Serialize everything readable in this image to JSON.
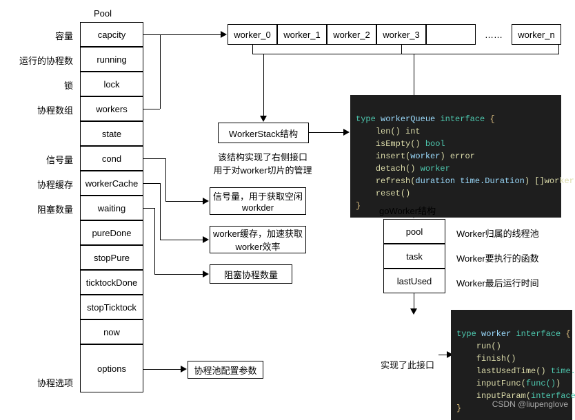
{
  "pool_title": "Pool",
  "pool_labels": {
    "capacity": "容量",
    "running": "运行的协程数",
    "lock": "锁",
    "workers": "协程数组",
    "cond": "信号量",
    "workerCache": "协程缓存",
    "waiting": "阻塞数量",
    "options": "协程选项"
  },
  "pool_fields": {
    "capacity": "capcity",
    "running": "running",
    "lock": "lock",
    "workers": "workers",
    "state": "state",
    "cond": "cond",
    "workerCache": "workerCache",
    "waiting": "waiting",
    "pureDone": "pureDone",
    "stopPure": "stopPure",
    "ticktockDone": "ticktockDone",
    "stopTicktock": "stopTicktock",
    "now": "now",
    "options": "options"
  },
  "workers": {
    "w0": "worker_0",
    "w1": "worker_1",
    "w2": "worker_2",
    "w3": "worker_3",
    "dots": "……",
    "wn": "worker_n"
  },
  "worker_stack": {
    "title": "WorkerStack结构",
    "desc": "该结构实现了右侧接口\n用于对worker切片的管理"
  },
  "notes": {
    "cond": "信号量，用于获取空闲workder",
    "workerCache": "worker缓存，加速获取worker效率",
    "waiting": "阻塞协程数量",
    "options": "协程池配置参数"
  },
  "go_worker": {
    "title": "goWorker结构",
    "fields": {
      "pool": "pool",
      "task": "task",
      "lastUsed": "lastUsed"
    },
    "field_notes": {
      "pool": "Worker归属的线程池",
      "task": "Worker要执行的函数",
      "lastUsed": "Worker最后运行时间"
    },
    "impl_note": "实现了此接口"
  },
  "code": {
    "worker_queue": {
      "line1_kw": "type ",
      "line1_name": "workerQueue ",
      "line1_iface": "interface ",
      "line1_brace": "{",
      "line2": "len() int",
      "line3_m": "isEmpty() ",
      "line3_r": "bool",
      "line4_m": "insert(",
      "line4_a": "worker",
      "line4_r": ") error",
      "line5_m": "detach() ",
      "line5_r": "worker",
      "line6_m": "refresh(",
      "line6_a": "duration time.Duration",
      "line6_r": ") []worker",
      "line7": "reset()",
      "line8": "}"
    },
    "worker": {
      "line1_kw": "type ",
      "line1_name": "worker ",
      "line1_iface": "interface ",
      "line1_brace": "{",
      "line2": "run()",
      "line3": "finish()",
      "line4_m": "lastUsedTime() ",
      "line4_r": "time.Time",
      "line5_m": "inputFunc(",
      "line5_a": "func()",
      "line5_r": ")",
      "line6_m": "inputParam(",
      "line6_a": "interface{}",
      "line6_r": ")",
      "line7": "}"
    }
  },
  "watermark": "CSDN @liupenglove"
}
